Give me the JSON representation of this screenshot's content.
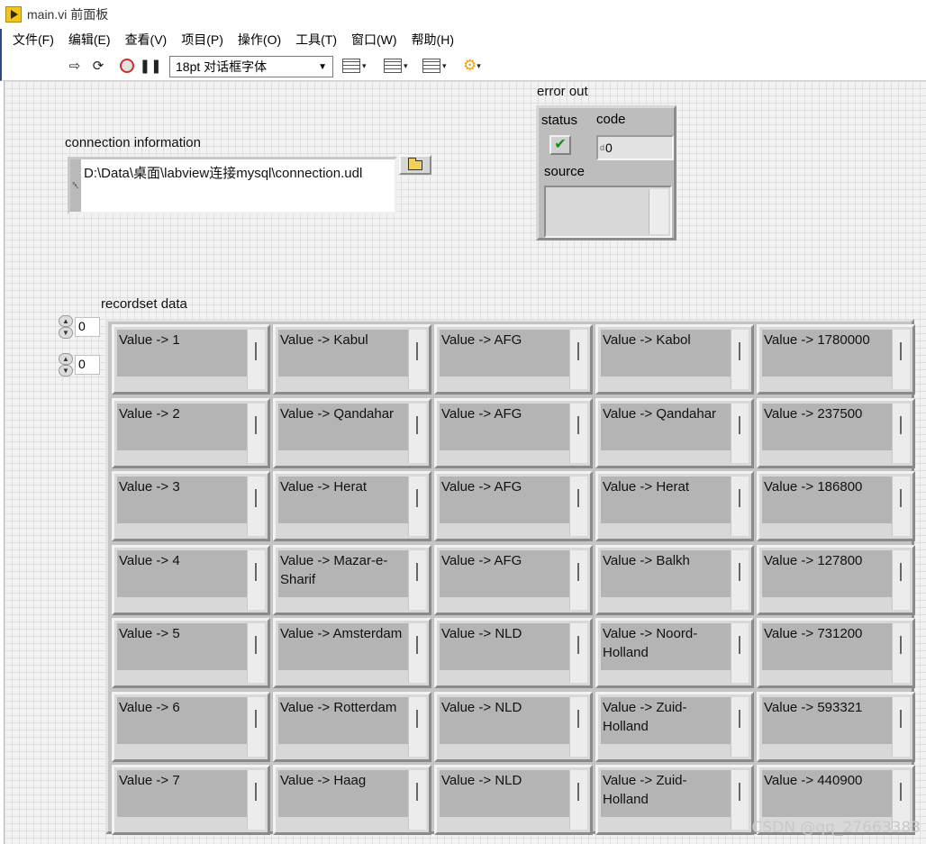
{
  "window": {
    "title": "main.vi 前面板"
  },
  "menu": [
    "文件(F)",
    "编辑(E)",
    "查看(V)",
    "项目(P)",
    "操作(O)",
    "工具(T)",
    "窗口(W)",
    "帮助(H)"
  ],
  "toolbar": {
    "font_select": "18pt 对话框字体"
  },
  "error_out": {
    "label": "error out",
    "status_label": "status",
    "code_label": "code",
    "code_value": "0",
    "source_label": "source",
    "status": true
  },
  "connection": {
    "label": "connection information",
    "path": "D:\\Data\\桌面\\labview连接mysql\\connection.udl"
  },
  "recordset": {
    "label": "recordset data",
    "index_row": "0",
    "index_col": "0",
    "rows": [
      [
        "Value -> 1",
        "Value -> Kabul",
        "Value -> AFG",
        "Value -> Kabol",
        "Value -> 1780000"
      ],
      [
        "Value -> 2",
        "Value -> Qandahar",
        "Value -> AFG",
        "Value -> Qandahar",
        "Value -> 237500"
      ],
      [
        "Value -> 3",
        "Value -> Herat",
        "Value -> AFG",
        "Value -> Herat",
        "Value -> 186800"
      ],
      [
        "Value -> 4",
        "Value -> Mazar-e-Sharif",
        "Value -> AFG",
        "Value -> Balkh",
        "Value -> 127800"
      ],
      [
        "Value -> 5",
        "Value -> Amsterdam",
        "Value -> NLD",
        "Value -> Noord-Holland",
        "Value -> 731200"
      ],
      [
        "Value -> 6",
        "Value -> Rotterdam",
        "Value -> NLD",
        "Value -> Zuid-Holland",
        "Value -> 593321"
      ],
      [
        "Value -> 7",
        "Value -> Haag",
        "Value -> NLD",
        "Value -> Zuid-Holland",
        "Value -> 440900"
      ]
    ]
  },
  "watermark": "CSDN @qq_27663383"
}
